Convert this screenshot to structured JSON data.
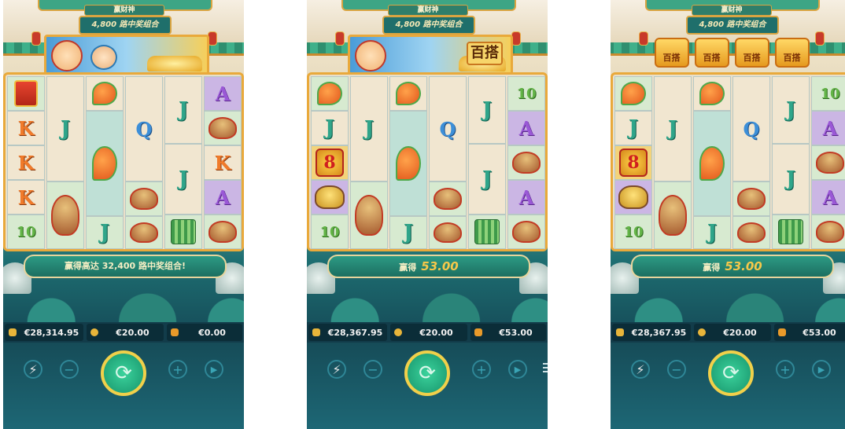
{
  "colors": {
    "gold": "#e9a93b",
    "teal": "#1f6f6b",
    "win_text": "#f6c84a"
  },
  "panels": [
    {
      "title": "赢财神",
      "ways": "4,800 路中奖组合",
      "top_feature": "banner",
      "top_text": "",
      "win_label": "赢得高达 32,400 路中奖组合!",
      "win_amount": "",
      "balance": "€28,314.95",
      "bet": "€20.00",
      "win": "€0.00"
    },
    {
      "title": "赢财神",
      "ways": "4,800 路中奖组合",
      "top_feature": "banner",
      "top_text": "百搭",
      "win_label": "赢得",
      "win_amount": "53.00",
      "balance": "€28,367.95",
      "bet": "€20.00",
      "win": "€53.00"
    },
    {
      "title": "赢财神",
      "ways": "4,800 路中奖组合",
      "top_feature": "ingots",
      "top_text": "百搭",
      "win_label": "赢得",
      "win_amount": "53.00",
      "balance": "€28,367.95",
      "bet": "€20.00",
      "win": "€53.00"
    }
  ],
  "grid_symbols": {
    "p1": [
      [
        "redbag",
        "K",
        "K",
        "K",
        "10"
      ],
      [
        "J",
        "J",
        "",
        "hat",
        ""
      ],
      [
        "shrimp",
        "",
        "shrimp",
        "",
        "J"
      ],
      [
        "Q",
        "",
        "",
        "hat",
        "hat"
      ],
      [
        "J",
        "",
        "J",
        "",
        "bamboo"
      ],
      [
        "A",
        "hat",
        "K",
        "A",
        "hat"
      ]
    ],
    "p2": [
      [
        "shrimp",
        "J",
        "eight",
        "toad",
        "10"
      ],
      [
        "J",
        "J",
        "",
        "hat",
        ""
      ],
      [
        "shrimp",
        "",
        "shrimp",
        "",
        "J"
      ],
      [
        "Q",
        "",
        "",
        "hat",
        "hat"
      ],
      [
        "J",
        "",
        "J",
        "",
        "bamboo"
      ],
      [
        "10",
        "A",
        "hat",
        "A",
        "hat"
      ]
    ],
    "p3": [
      [
        "shrimp",
        "J",
        "eight",
        "toad",
        "10"
      ],
      [
        "J",
        "J",
        "",
        "hat",
        ""
      ],
      [
        "shrimp",
        "",
        "shrimp",
        "",
        "J"
      ],
      [
        "Q",
        "",
        "",
        "hat",
        "hat"
      ],
      [
        "J",
        "",
        "J",
        "",
        "bamboo"
      ],
      [
        "10",
        "A",
        "hat",
        "A",
        "hat"
      ]
    ]
  },
  "controls": {
    "turbo_icon": "lightning-icon",
    "minus": "−",
    "plus": "+",
    "spin": "⟳",
    "auto": "▶"
  }
}
